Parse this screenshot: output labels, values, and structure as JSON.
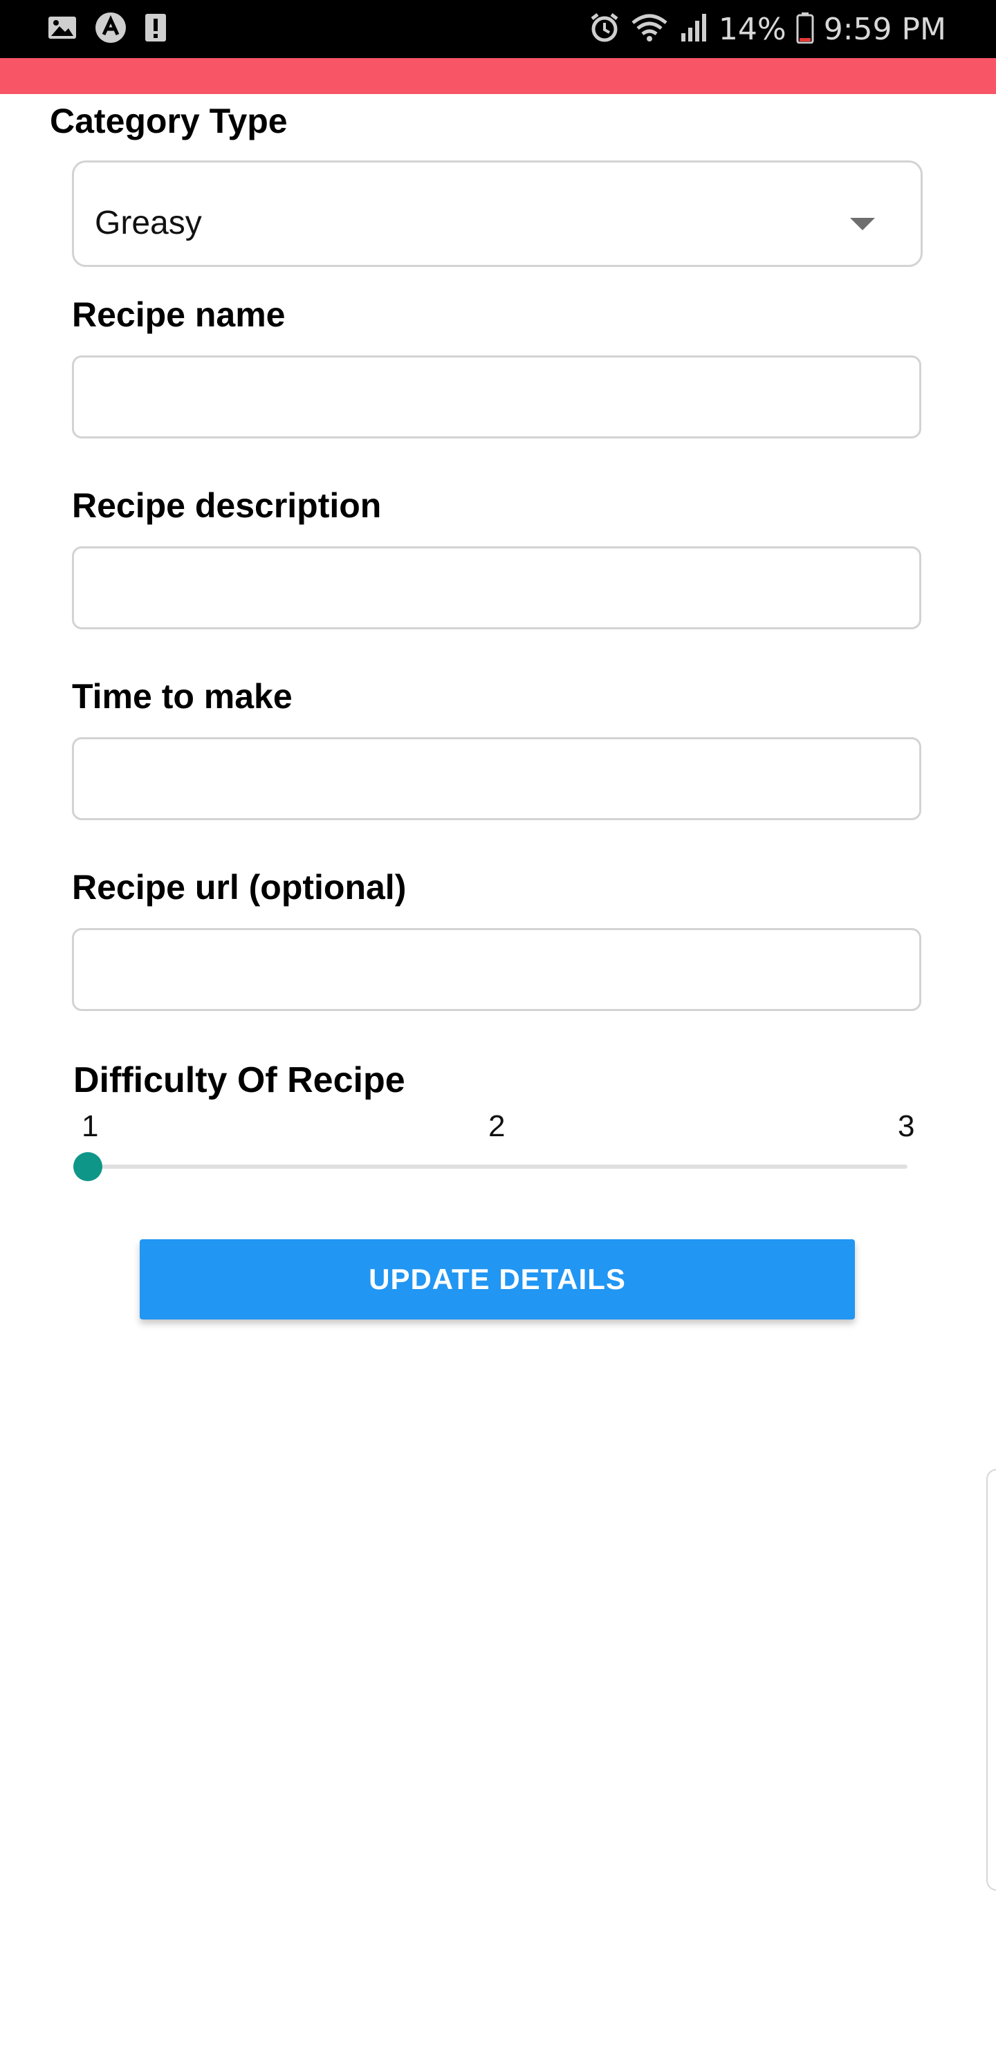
{
  "status_bar": {
    "battery_percent": "14%",
    "time": "9:59 PM",
    "left_icons": [
      "image-icon",
      "app-logo-icon",
      "alert-icon"
    ],
    "right_icons": [
      "alarm-icon",
      "wifi-icon",
      "signal-icon",
      "battery-icon"
    ]
  },
  "colors": {
    "accent_strip": "#f85566",
    "slider_thumb": "#0e9688",
    "button": "#2196f3"
  },
  "form": {
    "category_label": "Category Type",
    "category_value": "Greasy",
    "recipe_name_label": "Recipe name",
    "recipe_name_value": "",
    "recipe_description_label": "Recipe description",
    "recipe_description_value": "",
    "time_to_make_label": "Time to make",
    "time_to_make_value": "",
    "recipe_url_label": "Recipe url (optional)",
    "recipe_url_value": "",
    "difficulty_label": "Difficulty Of Recipe",
    "difficulty_ticks": [
      "1",
      "2",
      "3"
    ],
    "difficulty_value": 1,
    "update_button": "UPDATE DETAILS"
  }
}
